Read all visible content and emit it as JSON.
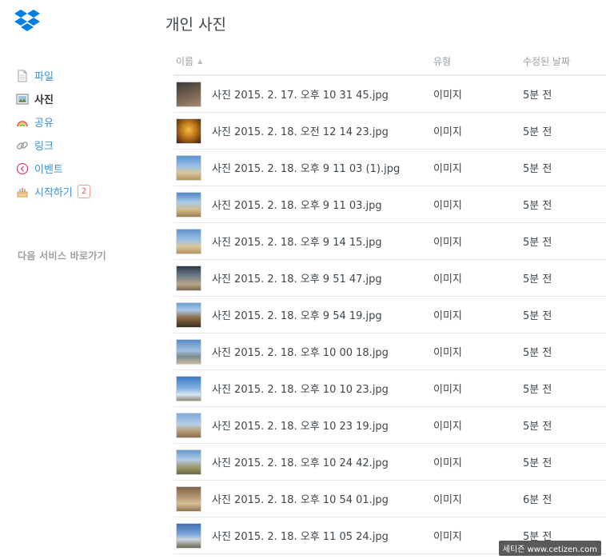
{
  "page_title": "개인 사진",
  "sidebar": {
    "items": [
      {
        "label": "파일",
        "icon": "file-icon",
        "active": false
      },
      {
        "label": "사진",
        "icon": "photo-icon",
        "active": true
      },
      {
        "label": "공유",
        "icon": "rainbow-icon",
        "active": false
      },
      {
        "label": "링크",
        "icon": "link-icon",
        "active": false
      },
      {
        "label": "이벤트",
        "icon": "clock-icon",
        "active": false
      },
      {
        "label": "시작하기",
        "icon": "cake-icon",
        "active": false,
        "badge": "2"
      }
    ],
    "section_label": "다음 서비스 바로가기"
  },
  "table": {
    "columns": {
      "name": "이름",
      "type": "유형",
      "date": "수정된 날짜"
    },
    "sort": "name-ascending",
    "rows": [
      {
        "name": "사진 2015. 2. 17. 오후 10 31 45.jpg",
        "type": "이미지",
        "date": "5분 전",
        "thumb": "dark"
      },
      {
        "name": "사진 2015. 2. 18. 오전 12 14 23.jpg",
        "type": "이미지",
        "date": "5분 전",
        "thumb": "gold"
      },
      {
        "name": "사진 2015. 2. 18. 오후 9 11 03 (1).jpg",
        "type": "이미지",
        "date": "5분 전",
        "thumb": "sky"
      },
      {
        "name": "사진 2015. 2. 18. 오후 9 11 03.jpg",
        "type": "이미지",
        "date": "5분 전",
        "thumb": "sky2"
      },
      {
        "name": "사진 2015. 2. 18. 오후 9 14 15.jpg",
        "type": "이미지",
        "date": "5분 전",
        "thumb": "sky"
      },
      {
        "name": "사진 2015. 2. 18. 오후 9 51 47.jpg",
        "type": "이미지",
        "date": "5분 전",
        "thumb": "court"
      },
      {
        "name": "사진 2015. 2. 18. 오후 9 54 19.jpg",
        "type": "이미지",
        "date": "5분 전",
        "thumb": "palace"
      },
      {
        "name": "사진 2015. 2. 18. 오후 10 00 18.jpg",
        "type": "이미지",
        "date": "5분 전",
        "thumb": "city"
      },
      {
        "name": "사진 2015. 2. 18. 오후 10 10 23.jpg",
        "type": "이미지",
        "date": "5분 전",
        "thumb": "tower"
      },
      {
        "name": "사진 2015. 2. 18. 오후 10 23 19.jpg",
        "type": "이미지",
        "date": "5분 전",
        "thumb": "plain"
      },
      {
        "name": "사진 2015. 2. 18. 오후 10 24 42.jpg",
        "type": "이미지",
        "date": "5분 전",
        "thumb": "field"
      },
      {
        "name": "사진 2015. 2. 18. 오후 10 54 01.jpg",
        "type": "이미지",
        "date": "6분 전",
        "thumb": "wall"
      },
      {
        "name": "사진 2015. 2. 18. 오후 11 05 24.jpg",
        "type": "이미지",
        "date": "5분 전",
        "thumb": "blue"
      }
    ]
  },
  "watermark": "세티즌 www.cetizen.com",
  "colors": {
    "accent": "#3d8fd4",
    "logo": "#007ee5",
    "badge": "#e05a5a"
  }
}
